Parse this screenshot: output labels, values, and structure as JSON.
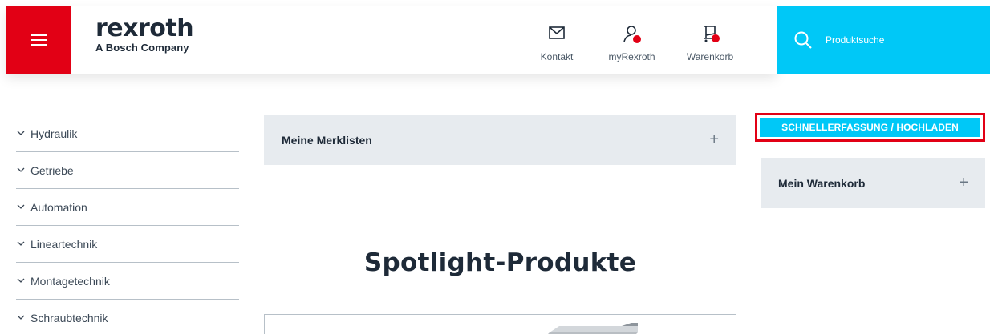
{
  "header": {
    "logo": {
      "word": "rexroth",
      "tagline": "A Bosch Company"
    },
    "links": [
      {
        "label": "Kontakt",
        "icon": "mail-icon"
      },
      {
        "label": "myRexroth",
        "icon": "user-icon"
      },
      {
        "label": "Warenkorb",
        "icon": "cart-icon"
      }
    ],
    "search": {
      "placeholder": "Produktsuche",
      "icon": "search-icon"
    }
  },
  "sidebar": {
    "items": [
      {
        "label": "Hydraulik"
      },
      {
        "label": "Getriebe"
      },
      {
        "label": "Automation"
      },
      {
        "label": "Lineartechnik"
      },
      {
        "label": "Montagetechnik"
      },
      {
        "label": "Schraubtechnik"
      }
    ]
  },
  "main": {
    "merklisten": {
      "label": "Meine Merklisten",
      "toggle": "+"
    },
    "spotlight_title": "Spotlight-Produkte"
  },
  "right": {
    "quick_entry": "SCHNELLERFASSUNG / HOCHLADEN",
    "cart": {
      "label": "Mein Warenkorb",
      "toggle": "+"
    }
  },
  "colors": {
    "brand_red": "#e20015",
    "accent_cyan": "#00c8f7",
    "panel_grey": "#e7ebef",
    "text_dark": "#1e2a38"
  }
}
